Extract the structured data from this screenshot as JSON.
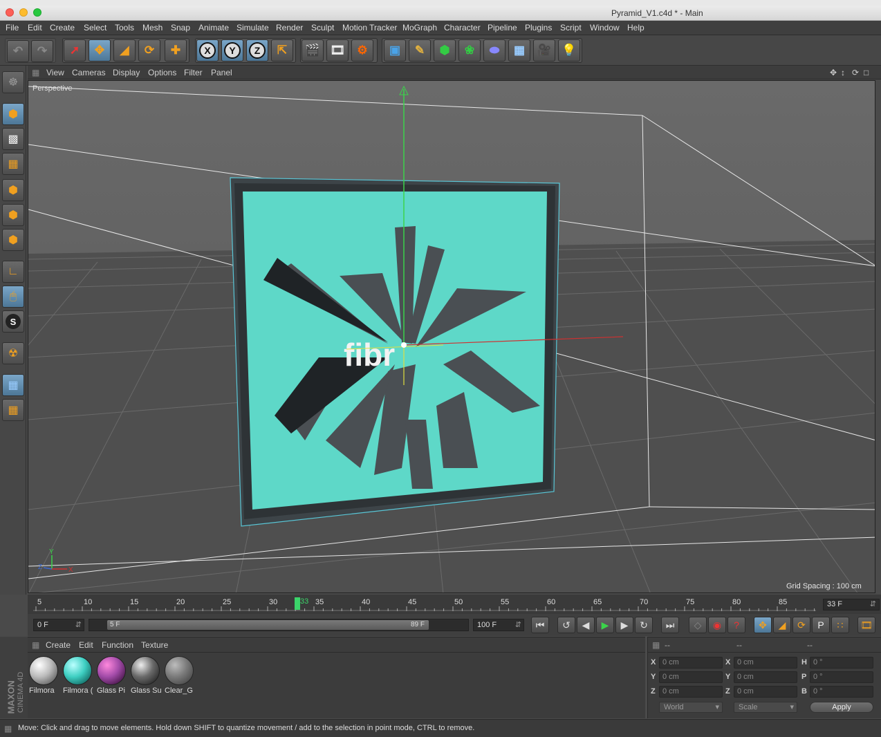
{
  "window": {
    "title": "Pyramid_V1.c4d * - Main"
  },
  "menu": [
    "File",
    "Edit",
    "Create",
    "Select",
    "Tools",
    "Mesh",
    "Snap",
    "Animate",
    "Simulate",
    "Render",
    "Sculpt",
    "Motion Tracker",
    "MoGraph",
    "Character",
    "Pipeline",
    "Plugins",
    "Script",
    "Window",
    "Help"
  ],
  "toolbar": {
    "axis_x": "X",
    "axis_y": "Y",
    "axis_z": "Z"
  },
  "viewport_menu": [
    "View",
    "Cameras",
    "Display",
    "Options",
    "Filter",
    "Panel"
  ],
  "viewport": {
    "camera_label": "Perspective",
    "grid_spacing": "Grid Spacing : 100 cm",
    "axis_y": "Y",
    "axis_z": "Z",
    "axis_x": "X",
    "logo_text": "fibr"
  },
  "timeline": {
    "ticks": [
      "5",
      "10",
      "15",
      "20",
      "25",
      "30",
      "35",
      "40",
      "45",
      "50",
      "55",
      "60",
      "65",
      "70",
      "75",
      "80",
      "85"
    ],
    "current_frame_marker": "33",
    "current_frame_field": "33 F"
  },
  "playback": {
    "start_field": "0 F",
    "range_start": "5 F",
    "range_end": "89 F",
    "end_field": "100 F"
  },
  "material_menu": [
    "Create",
    "Edit",
    "Function",
    "Texture"
  ],
  "materials": [
    {
      "name": "Filmora",
      "color": "#dddddd"
    },
    {
      "name": "Filmora (",
      "color": "#3ecfc2"
    },
    {
      "name": "Glass Pi",
      "color": "#a24ba8"
    },
    {
      "name": "Glass Su",
      "color": "#6a6a6a"
    },
    {
      "name": "Clear_G",
      "color": "#8a8a8a"
    }
  ],
  "coordinates": {
    "header": [
      "--",
      "--",
      "--"
    ],
    "rows": [
      {
        "l1": "X",
        "v1": "0 cm",
        "l2": "X",
        "v2": "0 cm",
        "l3": "H",
        "v3": "0 °"
      },
      {
        "l1": "Y",
        "v1": "0 cm",
        "l2": "Y",
        "v2": "0 cm",
        "l3": "P",
        "v3": "0 °"
      },
      {
        "l1": "Z",
        "v1": "0 cm",
        "l2": "Z",
        "v2": "0 cm",
        "l3": "B",
        "v3": "0 °"
      }
    ],
    "mode_select": "World",
    "size_select": "Scale",
    "apply_label": "Apply"
  },
  "brand": {
    "maxon": "MAXON",
    "product": "CINEMA 4D"
  },
  "status": "Move: Click and drag to move elements. Hold down SHIFT to quantize movement / add to the selection in point mode, CTRL to remove.",
  "colors": {
    "accent": "#f0a020",
    "teal": "#5ed8c8",
    "selection": "#59c6d6"
  }
}
